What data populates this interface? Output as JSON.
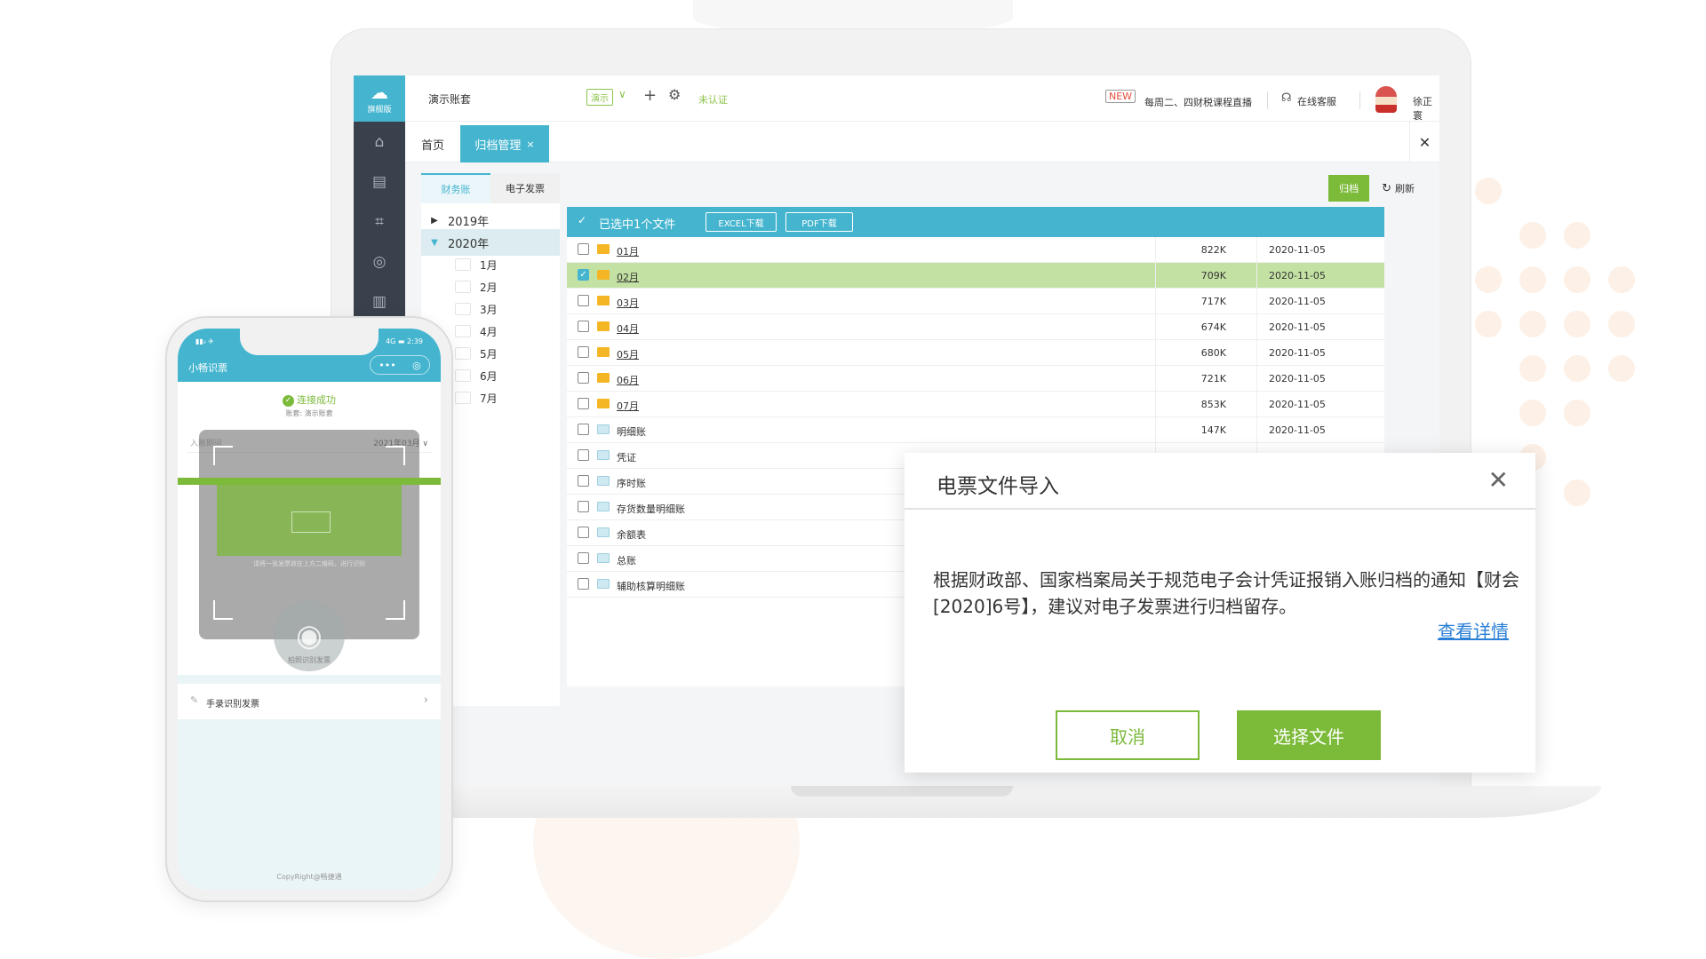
{
  "app": {
    "logo_version": "旗舰版",
    "account_name": "演示账套",
    "demo_tag": "演示",
    "unverified": "未认证",
    "live_badge": "NEW",
    "live_text": "每周二、四财税课程直播",
    "support_text": "在线客服",
    "user_name": "徐正寰"
  },
  "tabs": {
    "home": "首页",
    "active": "归档管理",
    "active_close": "×",
    "close_all": "✕"
  },
  "subtabs": [
    "财务账",
    "电子发票"
  ],
  "tree": {
    "years": [
      {
        "label": "2019年",
        "expanded": false
      },
      {
        "label": "2020年",
        "expanded": true
      }
    ],
    "months": [
      "1月",
      "2月",
      "3月",
      "4月",
      "5月",
      "6月",
      "7月"
    ]
  },
  "toolbar": {
    "archive_label": "归档",
    "refresh_label": "刷新"
  },
  "table": {
    "selected_info": "已选中1个文件",
    "excel_btn": "EXCEL下载",
    "pdf_btn": "PDF下载",
    "rows": [
      {
        "name": "01月",
        "size": "822K",
        "date": "2020-11-05",
        "type": "folder",
        "checked": false,
        "link": true
      },
      {
        "name": "02月",
        "size": "709K",
        "date": "2020-11-05",
        "type": "folder",
        "checked": true,
        "link": true
      },
      {
        "name": "03月",
        "size": "717K",
        "date": "2020-11-05",
        "type": "folder",
        "checked": false,
        "link": true
      },
      {
        "name": "04月",
        "size": "674K",
        "date": "2020-11-05",
        "type": "folder",
        "checked": false,
        "link": true
      },
      {
        "name": "05月",
        "size": "680K",
        "date": "2020-11-05",
        "type": "folder",
        "checked": false,
        "link": true
      },
      {
        "name": "06月",
        "size": "721K",
        "date": "2020-11-05",
        "type": "folder",
        "checked": false,
        "link": true
      },
      {
        "name": "07月",
        "size": "853K",
        "date": "2020-11-05",
        "type": "folder",
        "checked": false,
        "link": true
      },
      {
        "name": "明细账",
        "size": "147K",
        "date": "2020-11-05",
        "type": "book",
        "checked": false,
        "link": false
      },
      {
        "name": "凭证",
        "size": "",
        "date": "",
        "type": "book",
        "checked": false,
        "link": false
      },
      {
        "name": "序时账",
        "size": "",
        "date": "",
        "type": "book",
        "checked": false,
        "link": false
      },
      {
        "name": "存货数量明细账",
        "size": "",
        "date": "",
        "type": "book",
        "checked": false,
        "link": false
      },
      {
        "name": "余额表",
        "size": "",
        "date": "",
        "type": "book",
        "checked": false,
        "link": false
      },
      {
        "name": "总账",
        "size": "",
        "date": "",
        "type": "book",
        "checked": false,
        "link": false
      },
      {
        "name": "辅助核算明细账",
        "size": "",
        "date": "",
        "type": "book",
        "checked": false,
        "link": false
      }
    ]
  },
  "dialog": {
    "title": "电票文件导入",
    "close": "✕",
    "message": "根据财政部、国家档案局关于规范电子会计凭证报销入账归档的通知【财会[2020]6号】，建议对电子发票进行归档留存。",
    "detail_link": "查看详情",
    "cancel": "取消",
    "choose": "选择文件"
  },
  "phone": {
    "signal": "▮▮ᵢₗ ✈",
    "battery": "4G ▬ 2:39",
    "title": "小畅识票",
    "capsule_more": "•••",
    "capsule_close": "◎",
    "connected": "连接成功",
    "account": "账套: 演示账套",
    "date_left": "入账期间",
    "date_right": "2021年03月 ∨",
    "scan_hint": "请将一张发票放在上方二维码，进行识别",
    "camera_label": "拍照识别发票",
    "manual_label": "手录识别发票",
    "footer": "CopyRight@畅捷通"
  },
  "colors": {
    "accent": "#45b5cf",
    "green": "#7cba3a",
    "sidebar": "#39414d",
    "link": "#2a7fd6"
  },
  "icons": {
    "sidebar": [
      "home-icon",
      "voucher-icon",
      "chart-icon",
      "money-bag-icon",
      "archive-icon"
    ]
  }
}
